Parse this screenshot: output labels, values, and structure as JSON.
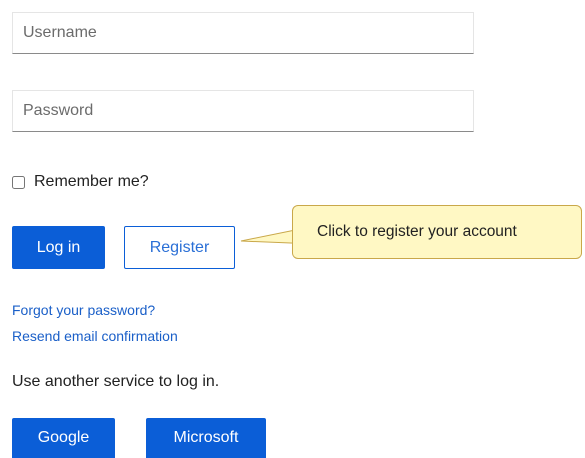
{
  "form": {
    "username_placeholder": "Username",
    "password_placeholder": "Password",
    "remember_label": "Remember me?",
    "login_label": "Log in",
    "register_label": "Register",
    "forgot_link": "Forgot your password?",
    "resend_link": "Resend email confirmation"
  },
  "external": {
    "heading": "Use another service to log in.",
    "google_label": "Google",
    "microsoft_label": "Microsoft"
  },
  "callout": {
    "text": "Click to register your account"
  },
  "colors": {
    "primary": "#0b5ed7",
    "link": "#1a5fc8",
    "callout_fill": "#fff8c4",
    "callout_border": "#c9a84a"
  }
}
